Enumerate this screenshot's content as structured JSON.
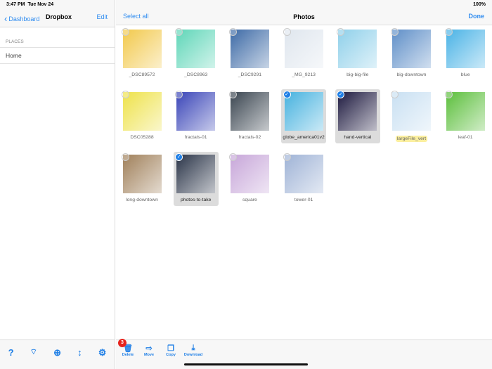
{
  "status": {
    "time": "3:47 PM",
    "date": "Tue Nov 24",
    "battery": "100%"
  },
  "sidebar": {
    "back_label": "Dashboard",
    "title": "Dropbox",
    "edit_label": "Edit",
    "section": "PLACES",
    "items": [
      {
        "label": "Home"
      }
    ],
    "bottom_icons": [
      "help-icon",
      "wifi-icon",
      "globe-icon",
      "sort-icon",
      "gear-icon"
    ]
  },
  "header": {
    "select_all": "Select all",
    "title": "Photos",
    "done": "Done"
  },
  "files": [
    {
      "name": "_DSC89572",
      "selected": false,
      "color": "#f2c94c"
    },
    {
      "name": "_DSC8963",
      "selected": false,
      "color": "#5fd6b8"
    },
    {
      "name": "_DSC9291",
      "selected": false,
      "color": "#3d6aa6"
    },
    {
      "name": "_MG_9213",
      "selected": false,
      "color": "#dfe6ee"
    },
    {
      "name": "big-big-file",
      "selected": false,
      "color": "#8fd0ea"
    },
    {
      "name": "big-downtown",
      "selected": false,
      "color": "#5f8fc8"
    },
    {
      "name": "blue",
      "selected": false,
      "color": "#4ab3e6"
    },
    {
      "name": "DSC05288",
      "selected": false,
      "color": "#eee24a"
    },
    {
      "name": "fractals-01",
      "selected": false,
      "color": "#3a45b8"
    },
    {
      "name": "fractals-02",
      "selected": false,
      "color": "#3a4550"
    },
    {
      "name": "globe_america01v2",
      "selected": true,
      "color": "#47b2df"
    },
    {
      "name": "hand-vertical",
      "selected": true,
      "color": "#1e1a40"
    },
    {
      "name": "largeFile_vert",
      "selected": false,
      "highlight": true,
      "color": "#c9e0f2"
    },
    {
      "name": "leaf-01",
      "selected": false,
      "color": "#5cbf3c"
    },
    {
      "name": "long-downtown",
      "selected": false,
      "color": "#a0805a"
    },
    {
      "name": "photos-to-take",
      "selected": true,
      "color": "#2a3448"
    },
    {
      "name": "square",
      "selected": false,
      "color": "#c7a6d9"
    },
    {
      "name": "tower-01",
      "selected": false,
      "color": "#9fb3d6"
    }
  ],
  "toolbar": {
    "badge": "3",
    "delete": "Delete",
    "move": "Move",
    "copy": "Copy",
    "download": "Download"
  }
}
